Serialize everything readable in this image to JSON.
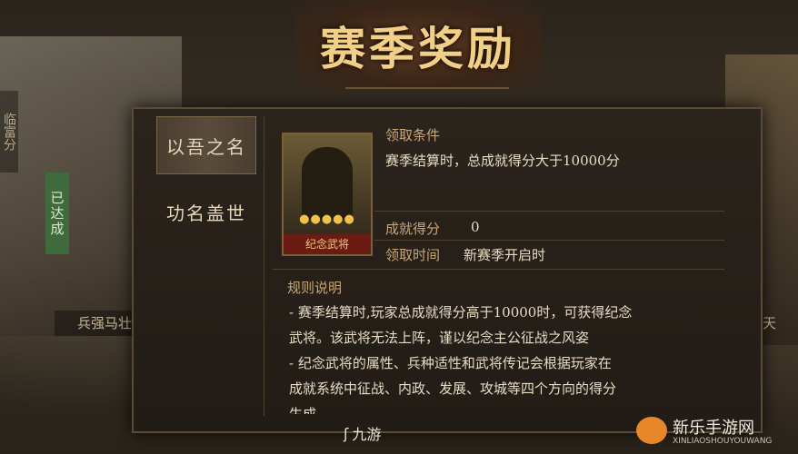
{
  "title": "赛季奖励",
  "background": {
    "left_banner": "已达成",
    "left_caption": "兵强马壮",
    "left_vertical": "临富分",
    "right_caption": "烽火连天"
  },
  "tabs": [
    {
      "label": "以吾之名",
      "active": true
    },
    {
      "label": "功名盖世",
      "active": false
    }
  ],
  "reward": {
    "portrait_label": "纪念武将",
    "stars": "●●●●●",
    "condition_label": "领取条件",
    "condition_text": "赛季结算时，总成就得分大于10000分",
    "score_label": "成就得分",
    "score_value": "0",
    "time_label": "领取时间",
    "time_value": "新赛季开启时"
  },
  "rules": {
    "heading": "规则说明",
    "lines": [
      "- 赛季结算时,玩家总成就得分高于10000时，可获得纪念",
      "武将。该武将无法上阵，谨以纪念主公征战之风姿",
      "- 纪念武将的属性、兵种适性和武将传记会根据玩家在",
      "成就系统中征战、内政、发展、攻城等四个方向的得分",
      "生成"
    ]
  },
  "watermarks": {
    "nine_game": "九游",
    "site_name": "新乐手游网",
    "site_url": "XINLIAOSHOUYOUWANG"
  },
  "colors": {
    "title_gold": "#f1cf86",
    "label_gold": "#c9a676",
    "text": "#e8dcc3",
    "banner_green": "#3f6b3c",
    "portrait_label_red": "#6b1a14"
  }
}
